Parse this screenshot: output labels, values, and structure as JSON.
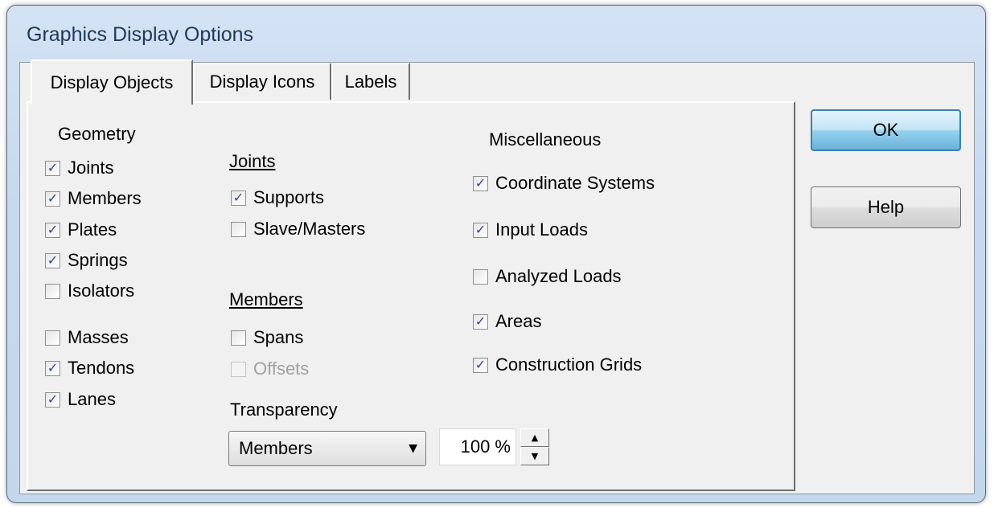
{
  "window": {
    "title": "Graphics Display Options"
  },
  "tabs": [
    {
      "label": "Display Objects",
      "active": true
    },
    {
      "label": "Display Icons",
      "active": false
    },
    {
      "label": "Labels",
      "active": false
    }
  ],
  "geometry": {
    "heading": "Geometry",
    "items": [
      {
        "label": "Joints",
        "checked": true
      },
      {
        "label": "Members",
        "checked": true
      },
      {
        "label": "Plates",
        "checked": true
      },
      {
        "label": "Springs",
        "checked": true
      },
      {
        "label": "Isolators",
        "checked": false
      },
      {
        "label": "Masses",
        "checked": false
      },
      {
        "label": "Tendons",
        "checked": true
      },
      {
        "label": "Lanes",
        "checked": true
      }
    ]
  },
  "joints": {
    "heading": "Joints",
    "items": [
      {
        "label": "Supports",
        "checked": true
      },
      {
        "label": "Slave/Masters",
        "checked": false
      }
    ]
  },
  "members": {
    "heading": "Members",
    "items": [
      {
        "label": "Spans",
        "checked": false,
        "disabled": false
      },
      {
        "label": "Offsets",
        "checked": false,
        "disabled": true
      }
    ]
  },
  "miscellaneous": {
    "heading": "Miscellaneous",
    "items": [
      {
        "label": "Coordinate Systems",
        "checked": true
      },
      {
        "label": "Input Loads",
        "checked": true
      },
      {
        "label": "Analyzed Loads",
        "checked": false
      },
      {
        "label": "Areas",
        "checked": true
      },
      {
        "label": "Construction Grids",
        "checked": true
      }
    ]
  },
  "transparency": {
    "label": "Transparency",
    "selected": "Members",
    "value": "100 %"
  },
  "buttons": {
    "ok": "OK",
    "help": "Help"
  },
  "icons": {
    "checkmark": "✓",
    "dropdown_arrow": "▼",
    "spin_up": "▲",
    "spin_down": "▼"
  }
}
